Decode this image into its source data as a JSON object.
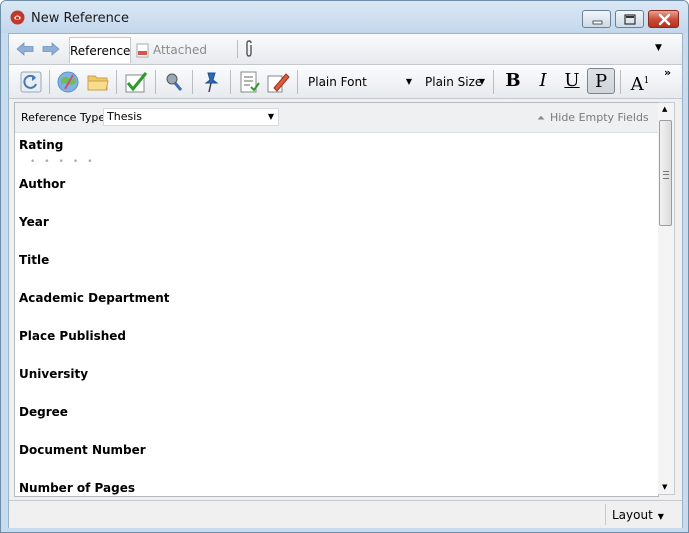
{
  "window": {
    "title": "New Reference"
  },
  "tabs": {
    "reference": "Reference",
    "attached_pdfs": "Attached PDFs"
  },
  "toolbar": {
    "font": "Plain Font",
    "size": "Plain Size",
    "bold": "B",
    "italic": "I",
    "underline": "U",
    "plain": "P",
    "superscript_base": "A",
    "superscript_exp": "1",
    "more": "»"
  },
  "reference_type": {
    "label": "Reference Type:",
    "value": "Thesis"
  },
  "hide_empty_fields": "Hide Empty Fields",
  "fields": [
    "Rating",
    "Author",
    "Year",
    "Title",
    "Academic Department",
    "Place Published",
    "University",
    "Degree",
    "Document Number",
    "Number of Pages"
  ],
  "rating": {
    "stars": 0,
    "max": 5
  },
  "status": {
    "layout": "Layout"
  }
}
